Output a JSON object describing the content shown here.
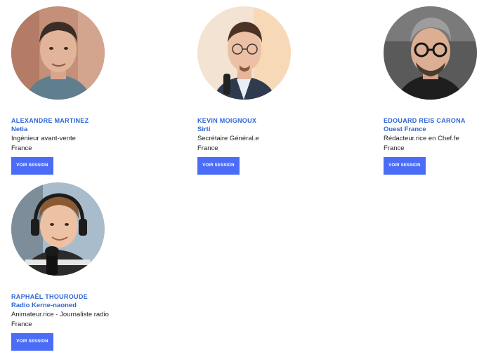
{
  "speakers": [
    {
      "name": "Alexandre Martinez",
      "org": "Netia",
      "role": "Ingénieur avant-vente",
      "country": "France",
      "button_label": "Voir session",
      "avatar_bg": "#c98a72"
    },
    {
      "name": "Kevin Moignoux",
      "org": "Sirti",
      "role": "Secrétaire Général.e",
      "country": "France",
      "button_label": "Voir session",
      "avatar_bg": "#f1e0cf"
    },
    {
      "name": "Edouard Reis Carona",
      "org": "Ouest France",
      "role": "Rédacteur.rice en Chef.fe",
      "country": "France",
      "button_label": "Voir session",
      "avatar_bg": "#6b6b6b"
    },
    {
      "name": "Raphaël Thouroude",
      "org": "Radio Kerne-naoned",
      "role": "Animateur.rice - Journaliste radio",
      "country": "France",
      "button_label": "Voir session",
      "avatar_bg": "#9fb6c8"
    }
  ],
  "colors": {
    "accent": "#2f66d6",
    "button": "#4a6cf7",
    "text": "#222222"
  }
}
